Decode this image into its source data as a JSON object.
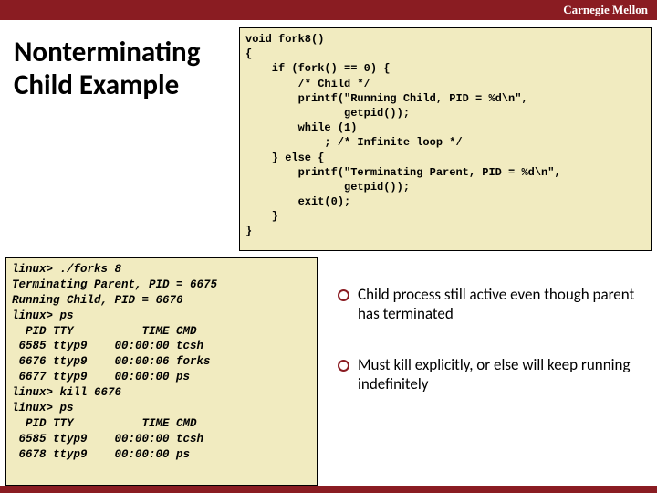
{
  "header": {
    "org": "Carnegie Mellon"
  },
  "title": "Nonterminating\nChild Example",
  "code": "void fork8()\n{\n    if (fork() == 0) {\n        /* Child */\n        printf(\"Running Child, PID = %d\\n\",\n               getpid());\n        while (1)\n            ; /* Infinite loop */\n    } else {\n        printf(\"Terminating Parent, PID = %d\\n\",\n               getpid());\n        exit(0);\n    }\n}",
  "shell": "linux> ./forks 8\nTerminating Parent, PID = 6675\nRunning Child, PID = 6676\nlinux> ps\n  PID TTY          TIME CMD\n 6585 ttyp9    00:00:00 tcsh\n 6676 ttyp9    00:00:06 forks\n 6677 ttyp9    00:00:00 ps\nlinux> kill 6676\nlinux> ps\n  PID TTY          TIME CMD\n 6585 ttyp9    00:00:00 tcsh\n 6678 ttyp9    00:00:00 ps",
  "bullets": [
    "Child process still active even though parent has terminated",
    "Must kill explicitly, or else will keep running indefinitely"
  ]
}
